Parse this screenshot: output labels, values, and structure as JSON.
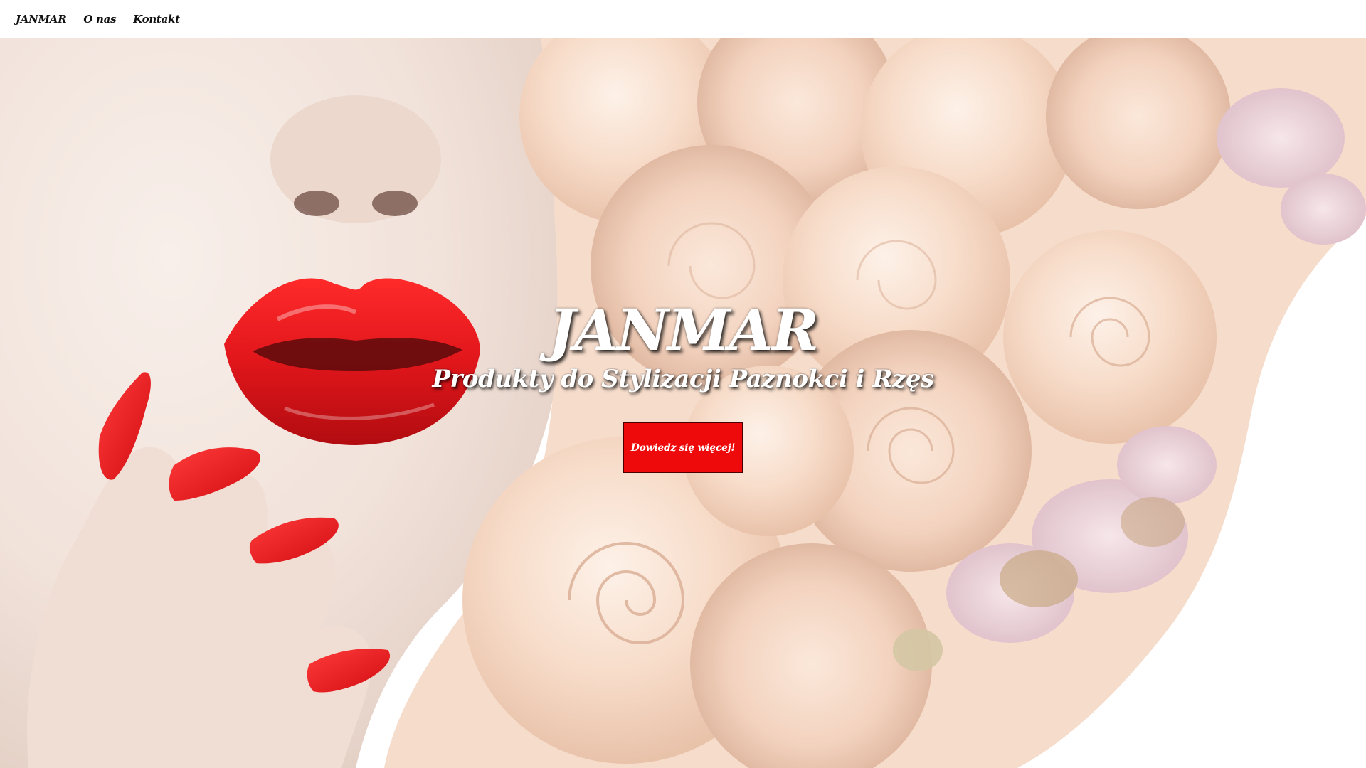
{
  "nav": {
    "items": [
      {
        "label": "JANMAR"
      },
      {
        "label": "O nas"
      },
      {
        "label": "Kontakt"
      }
    ]
  },
  "hero": {
    "title": "JANMAR",
    "subtitle": "Produkty do Stylizacji Paznokci i Rzęs",
    "cta_label": "Dowiedz się więcej!",
    "image_description_icon": "beauty-roses-photo"
  },
  "colors": {
    "accent": "#ee0a0a",
    "lip_red": "#e0161b",
    "rose": "#f6dccb",
    "skin": "#f3e4dc"
  }
}
